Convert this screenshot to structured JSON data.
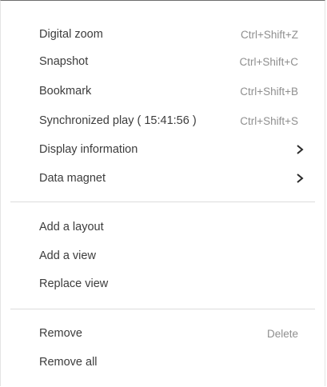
{
  "menu": {
    "group1": [
      {
        "label": "Digital zoom",
        "shortcut": "Ctrl+Shift+Z"
      },
      {
        "label": "Snapshot",
        "shortcut": "Ctrl+Shift+C"
      },
      {
        "label": "Bookmark",
        "shortcut": "Ctrl+Shift+B"
      },
      {
        "label": "Synchronized play ( 15:41:56 )",
        "shortcut": "Ctrl+Shift+S"
      },
      {
        "label": "Display information",
        "icon": "chevron-right-icon"
      },
      {
        "label": "Data magnet",
        "icon": "chevron-right-icon"
      }
    ],
    "group2": [
      {
        "label": "Add a layout"
      },
      {
        "label": "Add a view"
      },
      {
        "label": "Replace view"
      }
    ],
    "group3": [
      {
        "label": "Remove",
        "shortcut": "Delete"
      },
      {
        "label": "Remove all"
      }
    ]
  }
}
